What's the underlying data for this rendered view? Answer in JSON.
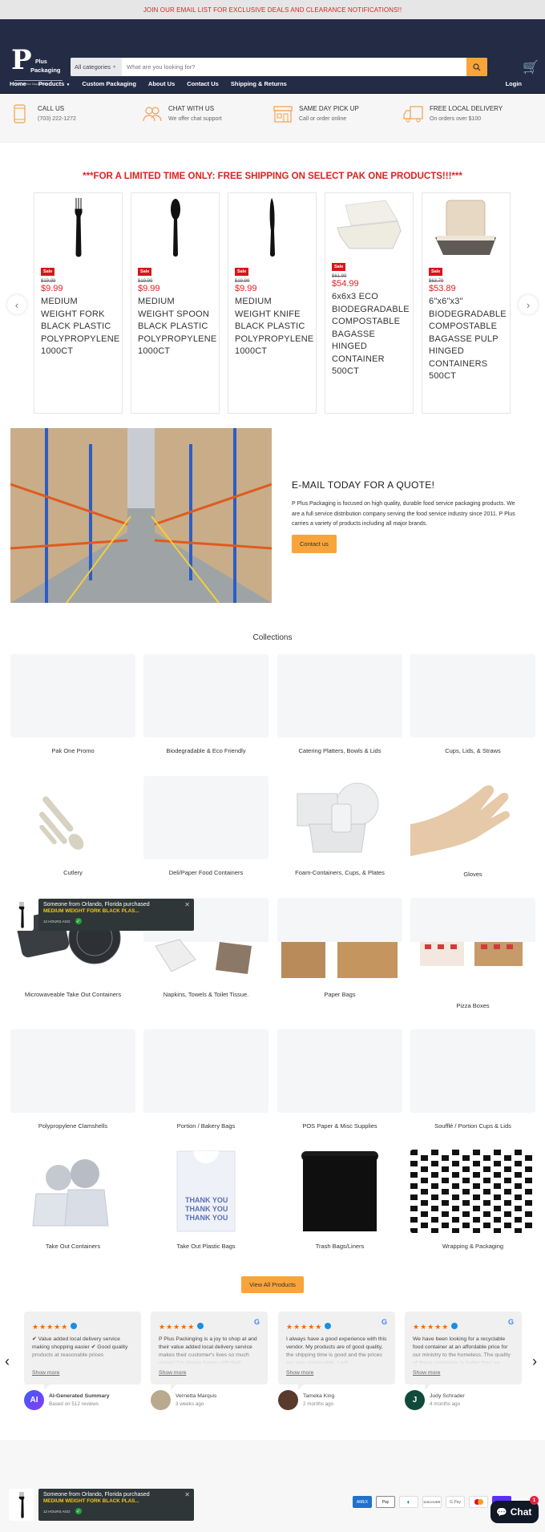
{
  "announcement": "JOIN OUR EMAIL LIST FOR EXCLUSIVE DEALS AND CLEARANCE NOTIFICATIONS!!",
  "logo": {
    "letter": "P",
    "line1": "Plus",
    "line2": "Packaging",
    "tagline": "Food Service Disposables"
  },
  "search": {
    "category": "All categories",
    "placeholder": "What are you looking for?"
  },
  "nav": {
    "items": [
      "Home",
      "Products",
      "Custom Packaging",
      "About Us",
      "Contact Us",
      "Shipping & Returns"
    ],
    "login": "Login"
  },
  "features": [
    {
      "title": "CALL US",
      "sub": "(703) 222-1272",
      "icon": "phone-icon"
    },
    {
      "title": "CHAT WITH US",
      "sub": "We offer chat support",
      "icon": "users-icon"
    },
    {
      "title": "SAME DAY PICK UP",
      "sub": "Call or order online",
      "icon": "store-icon"
    },
    {
      "title": "FREE LOCAL DELIVERY",
      "sub": "On orders over $100",
      "icon": "truck-icon"
    }
  ],
  "promo": "***FOR A LIMITED TIME ONLY: FREE SHIPPING ON SELECT PAK ONE PRODUCTS!!!***",
  "products": [
    {
      "badge": "Sale",
      "old": "$19.99",
      "price": "$9.99",
      "name": "MEDIUM WEIGHT FORK BLACK PLASTIC POLYPROPYLENE 1000CT"
    },
    {
      "badge": "Sale",
      "old": "$19.99",
      "price": "$9.99",
      "name": "MEDIUM WEIGHT SPOON BLACK PLASTIC POLYPROPYLENE 1000CT"
    },
    {
      "badge": "Sale",
      "old": "$19.99",
      "price": "$9.99",
      "name": "MEDIUM WEIGHT KNIFE BLACK PLASTIC POLYPROPYLENE 1000CT"
    },
    {
      "badge": "Sale",
      "old": "$61.99",
      "price": "$54.99",
      "name": "6x6x3 ECO BIODEGRADABLE COMPOSTABLE BAGASSE HINGED CONTAINER 500CT"
    },
    {
      "badge": "Sale",
      "old": "$63.79",
      "price": "$53.89",
      "name": "6\"x6\"x3\" BIODEGRADABLE COMPOSTABLE BAGASSE PULP HINGED CONTAINERS 500CT"
    }
  ],
  "quote": {
    "title": "E-MAIL TODAY FOR A QUOTE!",
    "body": "P Plus Packaging is focused on high quality, durable food service packaging products. We are a full service distribution company serving the food service industry since 2011. P Plus carries a variety of products including all major brands.",
    "button": "Contact us"
  },
  "collections": {
    "title": "Collections",
    "items": [
      "Pak One Promo",
      "Biodegradable & Eco Friendly",
      "Catering Platters, Bowls & Lids",
      "Cups, Lids, & Straws",
      "Cutlery",
      "Deli/Paper Food Containers",
      "Foam-Containers, Cups, & Plates",
      "Gloves",
      "Microwaveable Take Out Containers",
      "Napkins, Towels & Toilet Tissue.",
      "Paper Bags",
      "Pizza Boxes",
      "Polypropylene Clamshells",
      "Portion / Bakery Bags",
      "POS Paper & Misc Supplies",
      "Soufflé / Portion Cups & Lids",
      "Take Out Containers",
      "Take Out Plastic Bags",
      "Trash Bags/Liners",
      "Wrapping & Packaging"
    ]
  },
  "view_all": "View All Products",
  "reviews": [
    {
      "stars": "★★★★★",
      "text": "✔ Value added local delivery service making shopping easier ✔ Good quality products at reasonable prices",
      "more": "Show more",
      "author": "AI-Generated Summary",
      "meta": "Based on 512 reviews",
      "avatar": "AI",
      "google": false
    },
    {
      "stars": "★★★★★",
      "text": "P Plus Packinging is a joy to shop at and their value added local delivery service makes their customer's lives so much easier! I'm always happy with their",
      "more": "Show more",
      "author": "Vernetta Marquis",
      "meta": "3 weeks ago",
      "avatar": "",
      "google": true
    },
    {
      "stars": "★★★★★",
      "text": "I always have a good experience with this vendor. My products are of good quality, the shipping time is good and the prices are very reasonable. I will",
      "more": "Show more",
      "author": "Tameka King",
      "meta": "2 months ago",
      "avatar": "",
      "google": true
    },
    {
      "stars": "★★★★★",
      "text": "We have been looking for a recyclable food container at an affordable price for our ministry to the homeless. The quality of these containers is better than we",
      "more": "Show more",
      "author": "Judy Schrader",
      "meta": "4 months ago",
      "avatar": "J",
      "google": true
    }
  ],
  "toast": {
    "line1": "Someone from Orlando, Florida purchased",
    "line2": "MEDIUM WEIGHT FORK BLACK PLAS...",
    "time": "12 HOURS AGO"
  },
  "payments": [
    "AMEX",
    "Pay",
    "Diners",
    "DISCOVER",
    "G Pay",
    "Mastercard",
    "Shop"
  ],
  "chat": {
    "label": "Chat",
    "badge": "1"
  },
  "colors": {
    "navy": "#232b45",
    "orange": "#f9a43a",
    "red": "#e02020"
  }
}
